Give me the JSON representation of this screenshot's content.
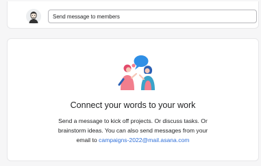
{
  "composer": {
    "input_value": "Send message to members",
    "avatar_icon": "user-avatar-icon"
  },
  "empty_state": {
    "illustration_icon": "people-chatting-illustration",
    "heading": "Connect your words to your work",
    "description_line1": "Send a message to kick off projects. Or discuss tasks. Or",
    "description_line2": "brainstorm ideas. You can also send messages from your",
    "description_line3_prefix": "email to",
    "email": "campaigns-2022@mail.asana.com"
  },
  "colors": {
    "link": "#2f6fd8",
    "bubble": "#2f8fe6",
    "person_pink": "#f27e8d",
    "person_blue": "#3aa3c9"
  }
}
